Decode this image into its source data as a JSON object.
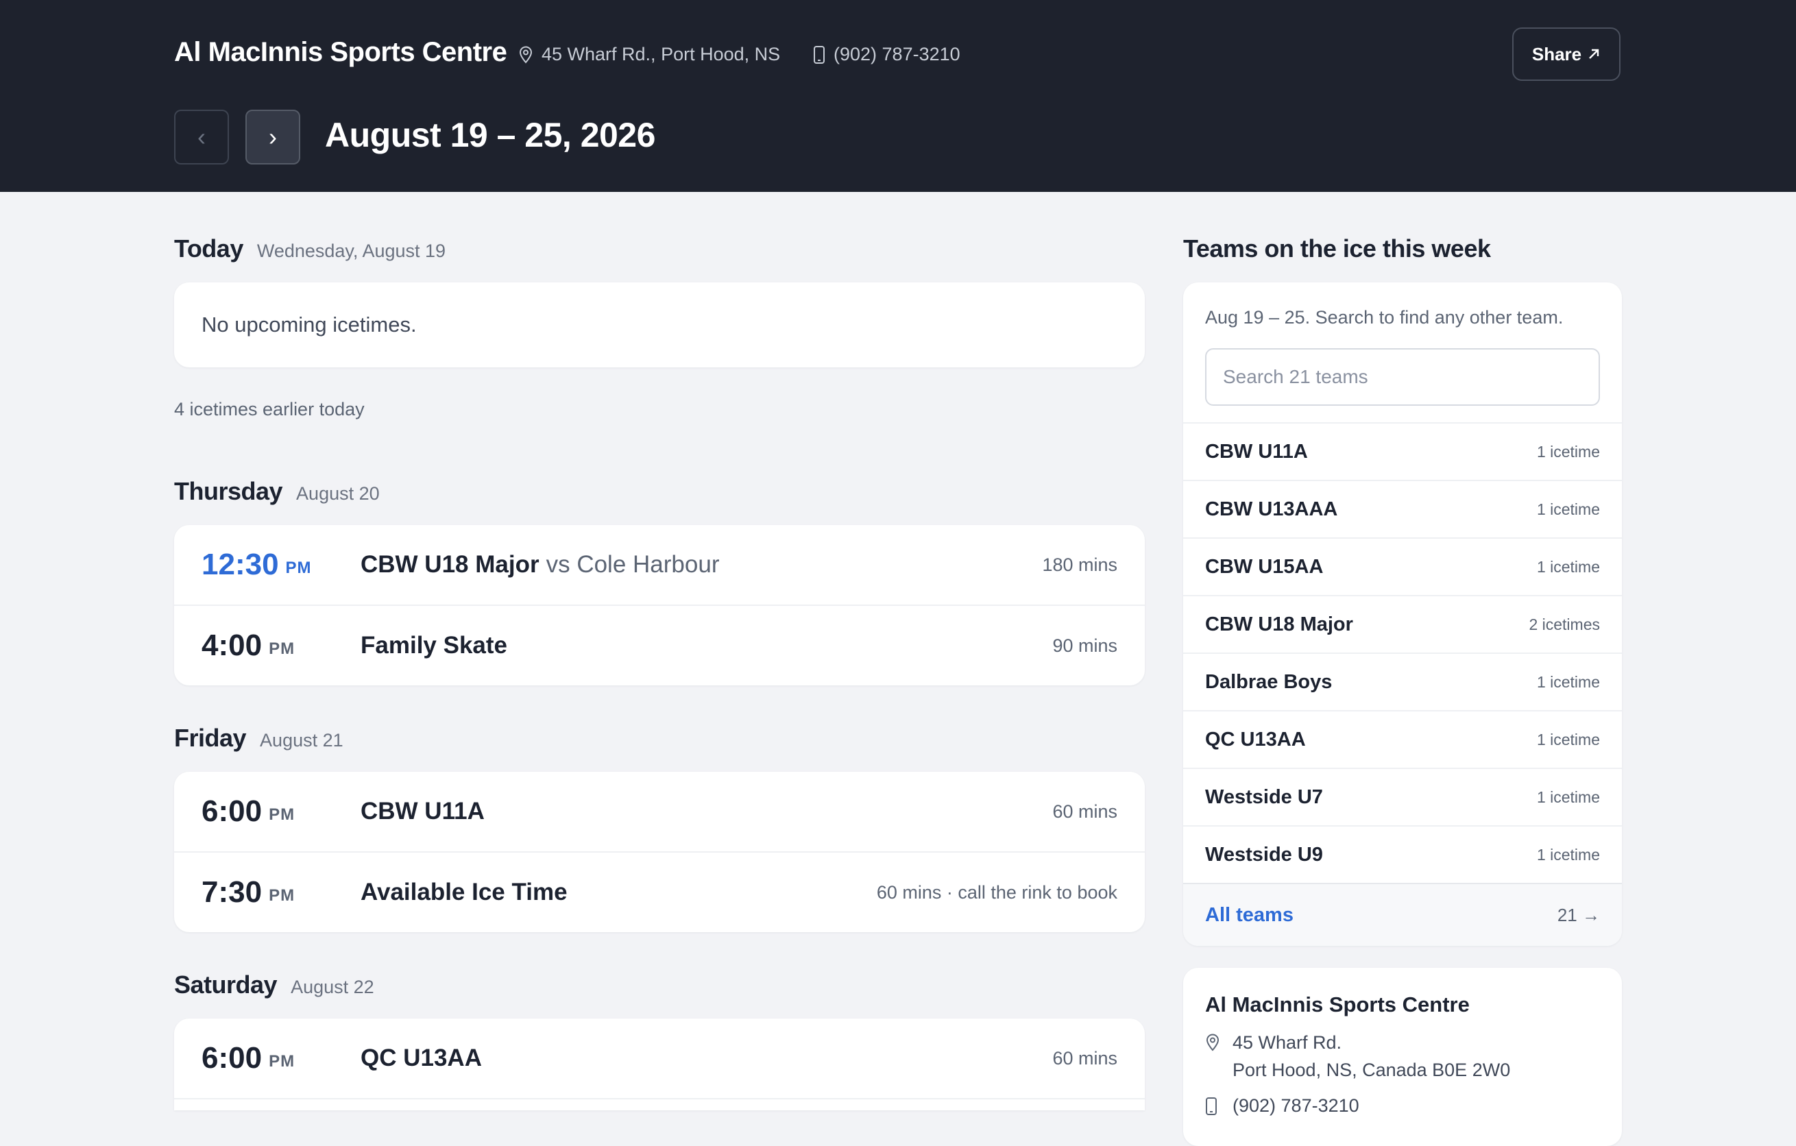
{
  "header": {
    "venue_name": "Al MacInnis Sports Centre",
    "address": "45 Wharf Rd., Port Hood, NS",
    "phone": "(902) 787-3210",
    "share_label": "Share",
    "share_icon": "arrow-up-right-icon",
    "prev_label": "‹",
    "next_label": "›",
    "week_title": "August 19 – 25, 2026"
  },
  "schedule": {
    "today": {
      "name": "Today",
      "date": "Wednesday, August 19",
      "empty_text": "No upcoming icetimes.",
      "earlier_text": "4 icetimes earlier today"
    },
    "days": [
      {
        "name": "Thursday",
        "date": "August 20",
        "events": [
          {
            "time": "12:30",
            "ampm": "PM",
            "title": "CBW U18 Major",
            "vs": "vs Cole Harbour",
            "duration": "180 mins"
          },
          {
            "time": "4:00",
            "ampm": "PM",
            "title": "Family Skate",
            "duration": "90 mins"
          }
        ]
      },
      {
        "name": "Friday",
        "date": "August 21",
        "events": [
          {
            "time": "6:00",
            "ampm": "PM",
            "title": "CBW U11A",
            "duration": "60 mins"
          },
          {
            "time": "7:30",
            "ampm": "PM",
            "title": "Available Ice Time",
            "duration": "60 mins · call the rink to book"
          }
        ]
      },
      {
        "name": "Saturday",
        "date": "August 22",
        "events": [
          {
            "time": "6:00",
            "ampm": "PM",
            "title": "QC U13AA",
            "duration": "60 mins"
          }
        ]
      }
    ]
  },
  "teams_panel": {
    "title": "Teams on the ice this week",
    "subtitle": "Aug 19 – 25. Search to find any other team.",
    "search_placeholder": "Search 21 teams",
    "teams": [
      {
        "name": "CBW U11A",
        "count": "1 icetime"
      },
      {
        "name": "CBW U13AAA",
        "count": "1 icetime"
      },
      {
        "name": "CBW U15AA",
        "count": "1 icetime"
      },
      {
        "name": "CBW U18 Major",
        "count": "2 icetimes"
      },
      {
        "name": "Dalbrae Boys",
        "count": "1 icetime"
      },
      {
        "name": "QC U13AA",
        "count": "1 icetime"
      },
      {
        "name": "Westside U7",
        "count": "1 icetime"
      },
      {
        "name": "Westside U9",
        "count": "1 icetime"
      }
    ],
    "all_teams_label": "All teams",
    "all_teams_count": "21 →"
  },
  "venue_card": {
    "name": "Al MacInnis Sports Centre",
    "address_line1": "45 Wharf Rd.",
    "address_line2": "Port Hood, NS, Canada B0E 2W0",
    "phone": "(902) 787-3210"
  },
  "colors": {
    "header_bg": "#1e222d",
    "page_bg": "#f2f3f6",
    "accent": "#2e6bd6"
  }
}
